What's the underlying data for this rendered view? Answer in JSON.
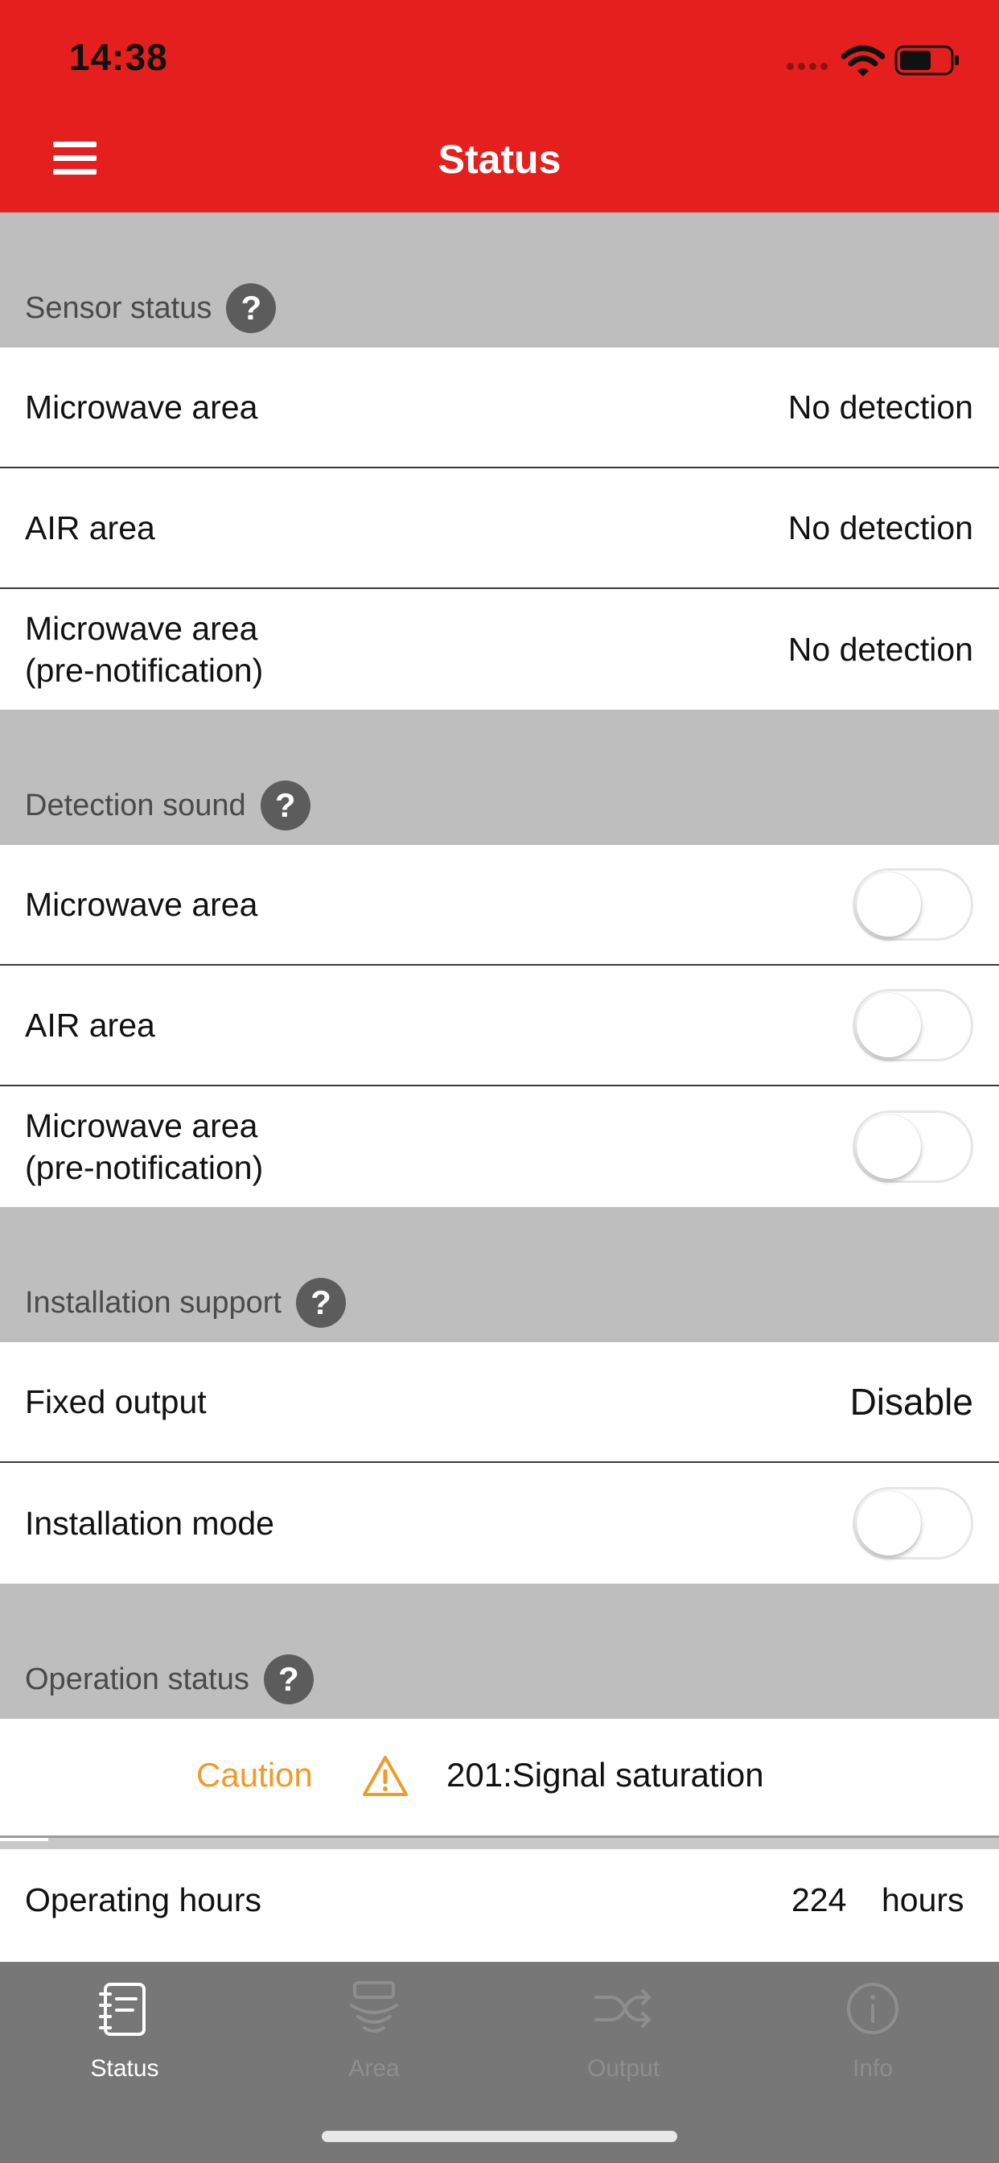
{
  "status_bar": {
    "time": "14:38"
  },
  "nav": {
    "title": "Status",
    "menu_icon": "hamburger-menu-icon"
  },
  "sensor_status": {
    "title": "Sensor status",
    "rows": [
      {
        "label": "Microwave area",
        "value": "No detection"
      },
      {
        "label": "AIR area",
        "value": "No detection"
      },
      {
        "label_line1": "Microwave area",
        "label_line2": "(pre-notification)",
        "value": "No detection"
      }
    ]
  },
  "detection_sound": {
    "title": "Detection sound",
    "rows": [
      {
        "label": "Microwave area",
        "enabled": false
      },
      {
        "label": "AIR area",
        "enabled": false
      },
      {
        "label_line1": "Microwave area",
        "label_line2": "(pre-notification)",
        "enabled": false
      }
    ]
  },
  "installation_support": {
    "title": "Installation support",
    "fixed_output": {
      "label": "Fixed output",
      "value": "Disable"
    },
    "installation_mode": {
      "label": "Installation mode",
      "enabled": false
    }
  },
  "operation_status": {
    "title": "Operation status",
    "level": "Caution",
    "message": "201:Signal saturation",
    "level_color": "#f29a29"
  },
  "operating_hours": {
    "label": "Operating hours",
    "value": "224",
    "unit": "hours"
  },
  "tabs": [
    {
      "label": "Status",
      "icon": "notebook-icon",
      "active": true
    },
    {
      "label": "Area",
      "icon": "area-waves-icon",
      "active": false
    },
    {
      "label": "Output",
      "icon": "shuffle-icon",
      "active": false
    },
    {
      "label": "Info",
      "icon": "info-icon",
      "active": false
    }
  ],
  "colors": {
    "brand_red": "#e51f1d",
    "section_gray": "#bebebe",
    "tabbar_gray": "#777777"
  }
}
